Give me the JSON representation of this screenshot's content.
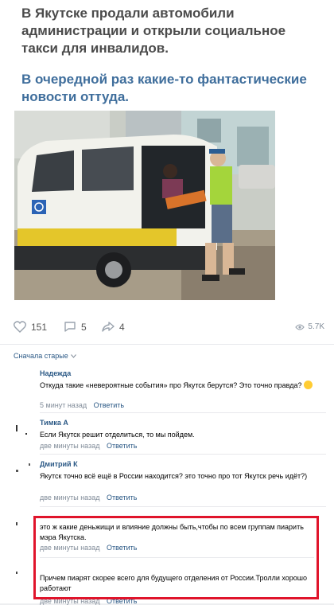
{
  "post": {
    "title": "В Якутске продали автомобили администрации и открыли социальное такси для инвалидов.",
    "subtitle": "В очередной раз какие-то фантастические новости оттуда."
  },
  "actions": {
    "likes": "151",
    "comments": "5",
    "shares": "4",
    "views": "5.7K"
  },
  "comments_sort": "Сначала старые",
  "comments": [
    {
      "author": "Надежда",
      "text": "Откуда такие «невероятные события» про Якутск берутся? Это точно правда?",
      "time": "5 минут назад",
      "reply": "Ответить"
    },
    {
      "author": "Тимка А",
      "text": "Если Якутск решит отделиться, то мы пойдем.",
      "time": "две минуты назад",
      "reply": "Ответить"
    },
    {
      "author": "Дмитрий К",
      "text": "Якутск точно всё ещё в России находится? это точно про тот Якутск речь идёт?)",
      "time": "две минуты назад",
      "reply": "Ответить"
    },
    {
      "author": "",
      "text": "это ж какие деньжищи и влияние должны быть,чтобы по всем группам пиарить мэра Якутска.",
      "time": "две минуты назад",
      "reply": "Ответить"
    },
    {
      "author": "",
      "text": "Причем пиарят скорее всего для будущего отделения от России.Тролли хорошо работают",
      "time": "две минуты назад",
      "reply": "Ответить"
    }
  ],
  "colors": {
    "link": "#2a5885",
    "subtitle": "#3f6e9c",
    "highlight": "#e0142b"
  }
}
